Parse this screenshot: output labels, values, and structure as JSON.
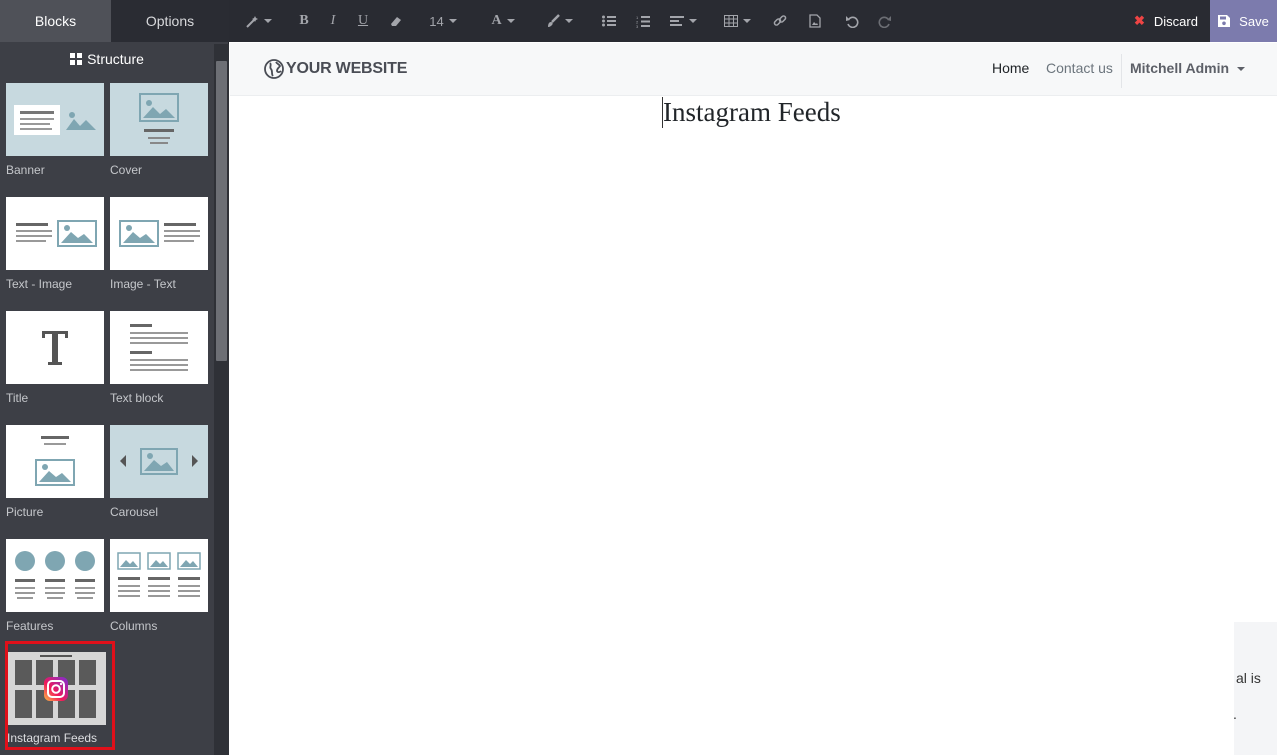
{
  "sidebar": {
    "tabs": [
      {
        "label": "Blocks"
      },
      {
        "label": "Options"
      }
    ],
    "heading": "Structure",
    "snippets": [
      {
        "label": "Banner"
      },
      {
        "label": "Cover"
      },
      {
        "label": "Text - Image"
      },
      {
        "label": "Image - Text"
      },
      {
        "label": "Title"
      },
      {
        "label": "Text block"
      },
      {
        "label": "Picture"
      },
      {
        "label": "Carousel"
      },
      {
        "label": "Features"
      },
      {
        "label": "Columns"
      },
      {
        "label": "Instagram Feeds"
      }
    ]
  },
  "toolbar": {
    "font_size": "14",
    "discard_label": "Discard",
    "save_label": "Save"
  },
  "site": {
    "logo_text": "YOUR WEBSITE",
    "nav": {
      "home": "Home",
      "contact": "Contact us",
      "user": "Mitchell Admin"
    },
    "page_title": "Instagram Feeds",
    "card_text_1": "al is",
    "card_text_2": "."
  },
  "colors": {
    "sidebar_bg": "#3d3f46",
    "toolbar_bg": "#292b32",
    "save_bg": "#7c7bad",
    "highlight": "#e0101a",
    "snippet_blue": "#c7d9df"
  }
}
